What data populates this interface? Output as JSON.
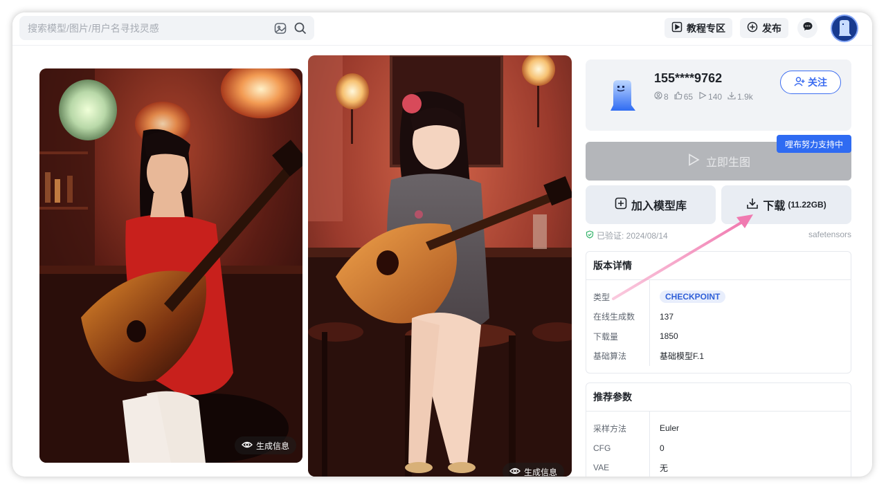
{
  "search": {
    "placeholder": "搜索模型/图片/用户名寻找灵感"
  },
  "header": {
    "tutorial_label": "教程专区",
    "publish_label": "发布"
  },
  "gallery": {
    "gen_info_label": "生成信息"
  },
  "user": {
    "name": "155****9762",
    "follow_label": "关注",
    "stats": {
      "a": "8",
      "b": "65",
      "c": "140",
      "d": "1.9k"
    }
  },
  "actions": {
    "support_badge": "哩布努力支持中",
    "generate_label": "立即生图",
    "add_library_label": "加入模型库",
    "download_label": "下载",
    "download_size": "(11.22GB)"
  },
  "verify": {
    "text": "已验证: 2024/08/14",
    "format": "safetensors"
  },
  "version_details": {
    "title": "版本详情",
    "rows": [
      {
        "k": "类型",
        "v": "CHECKPOINT"
      },
      {
        "k": "在线生成数",
        "v": "137"
      },
      {
        "k": "下载量",
        "v": "1850"
      },
      {
        "k": "基础算法",
        "v": "基础模型F.1"
      }
    ]
  },
  "recommended_params": {
    "title": "推荐参数",
    "rows": [
      {
        "k": "采样方法",
        "v": "Euler"
      },
      {
        "k": "CFG",
        "v": "0"
      },
      {
        "k": "VAE",
        "v": "无"
      }
    ]
  },
  "colors": {
    "accent": "#3b6cf0",
    "arrow": "#f07ab0",
    "badge": "#2f6bf2"
  }
}
